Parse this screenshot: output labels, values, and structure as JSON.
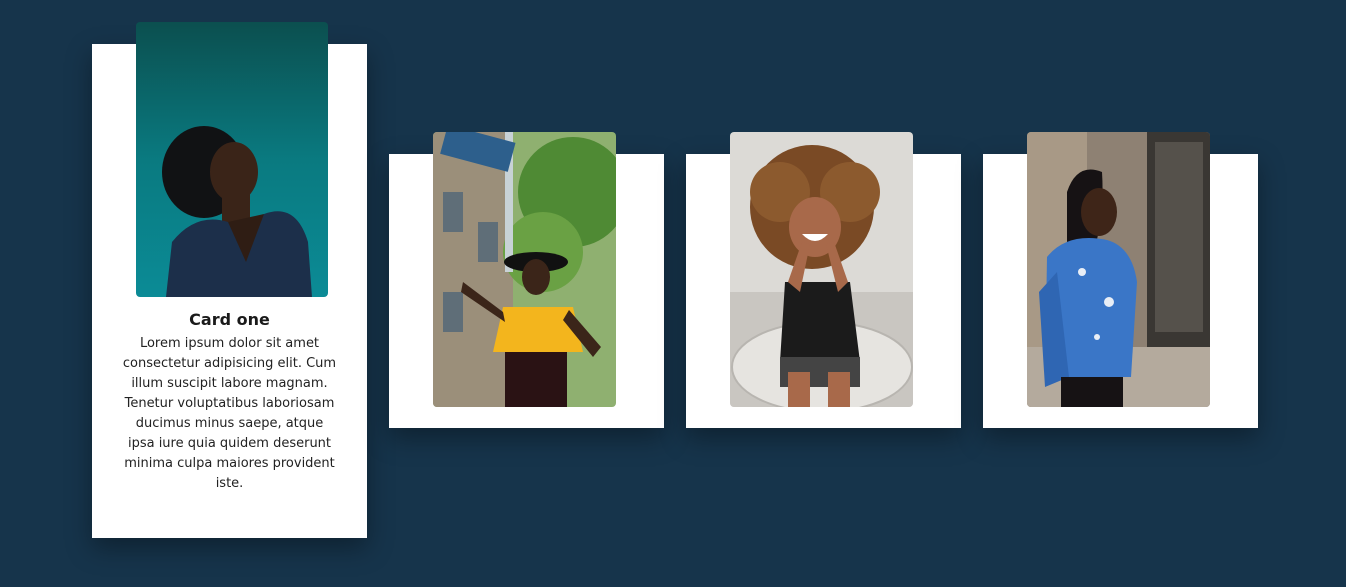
{
  "cards": [
    {
      "title": "Card one",
      "text": "Lorem ipsum dolor sit amet consectetur adipisicing elit. Cum illum suscipit labore magnam. Tenetur voluptatibus laboriosam ducimus minus saepe, atque ipsa iure quia quidem deserunt minima culpa maiores provident iste."
    },
    {},
    {},
    {}
  ]
}
